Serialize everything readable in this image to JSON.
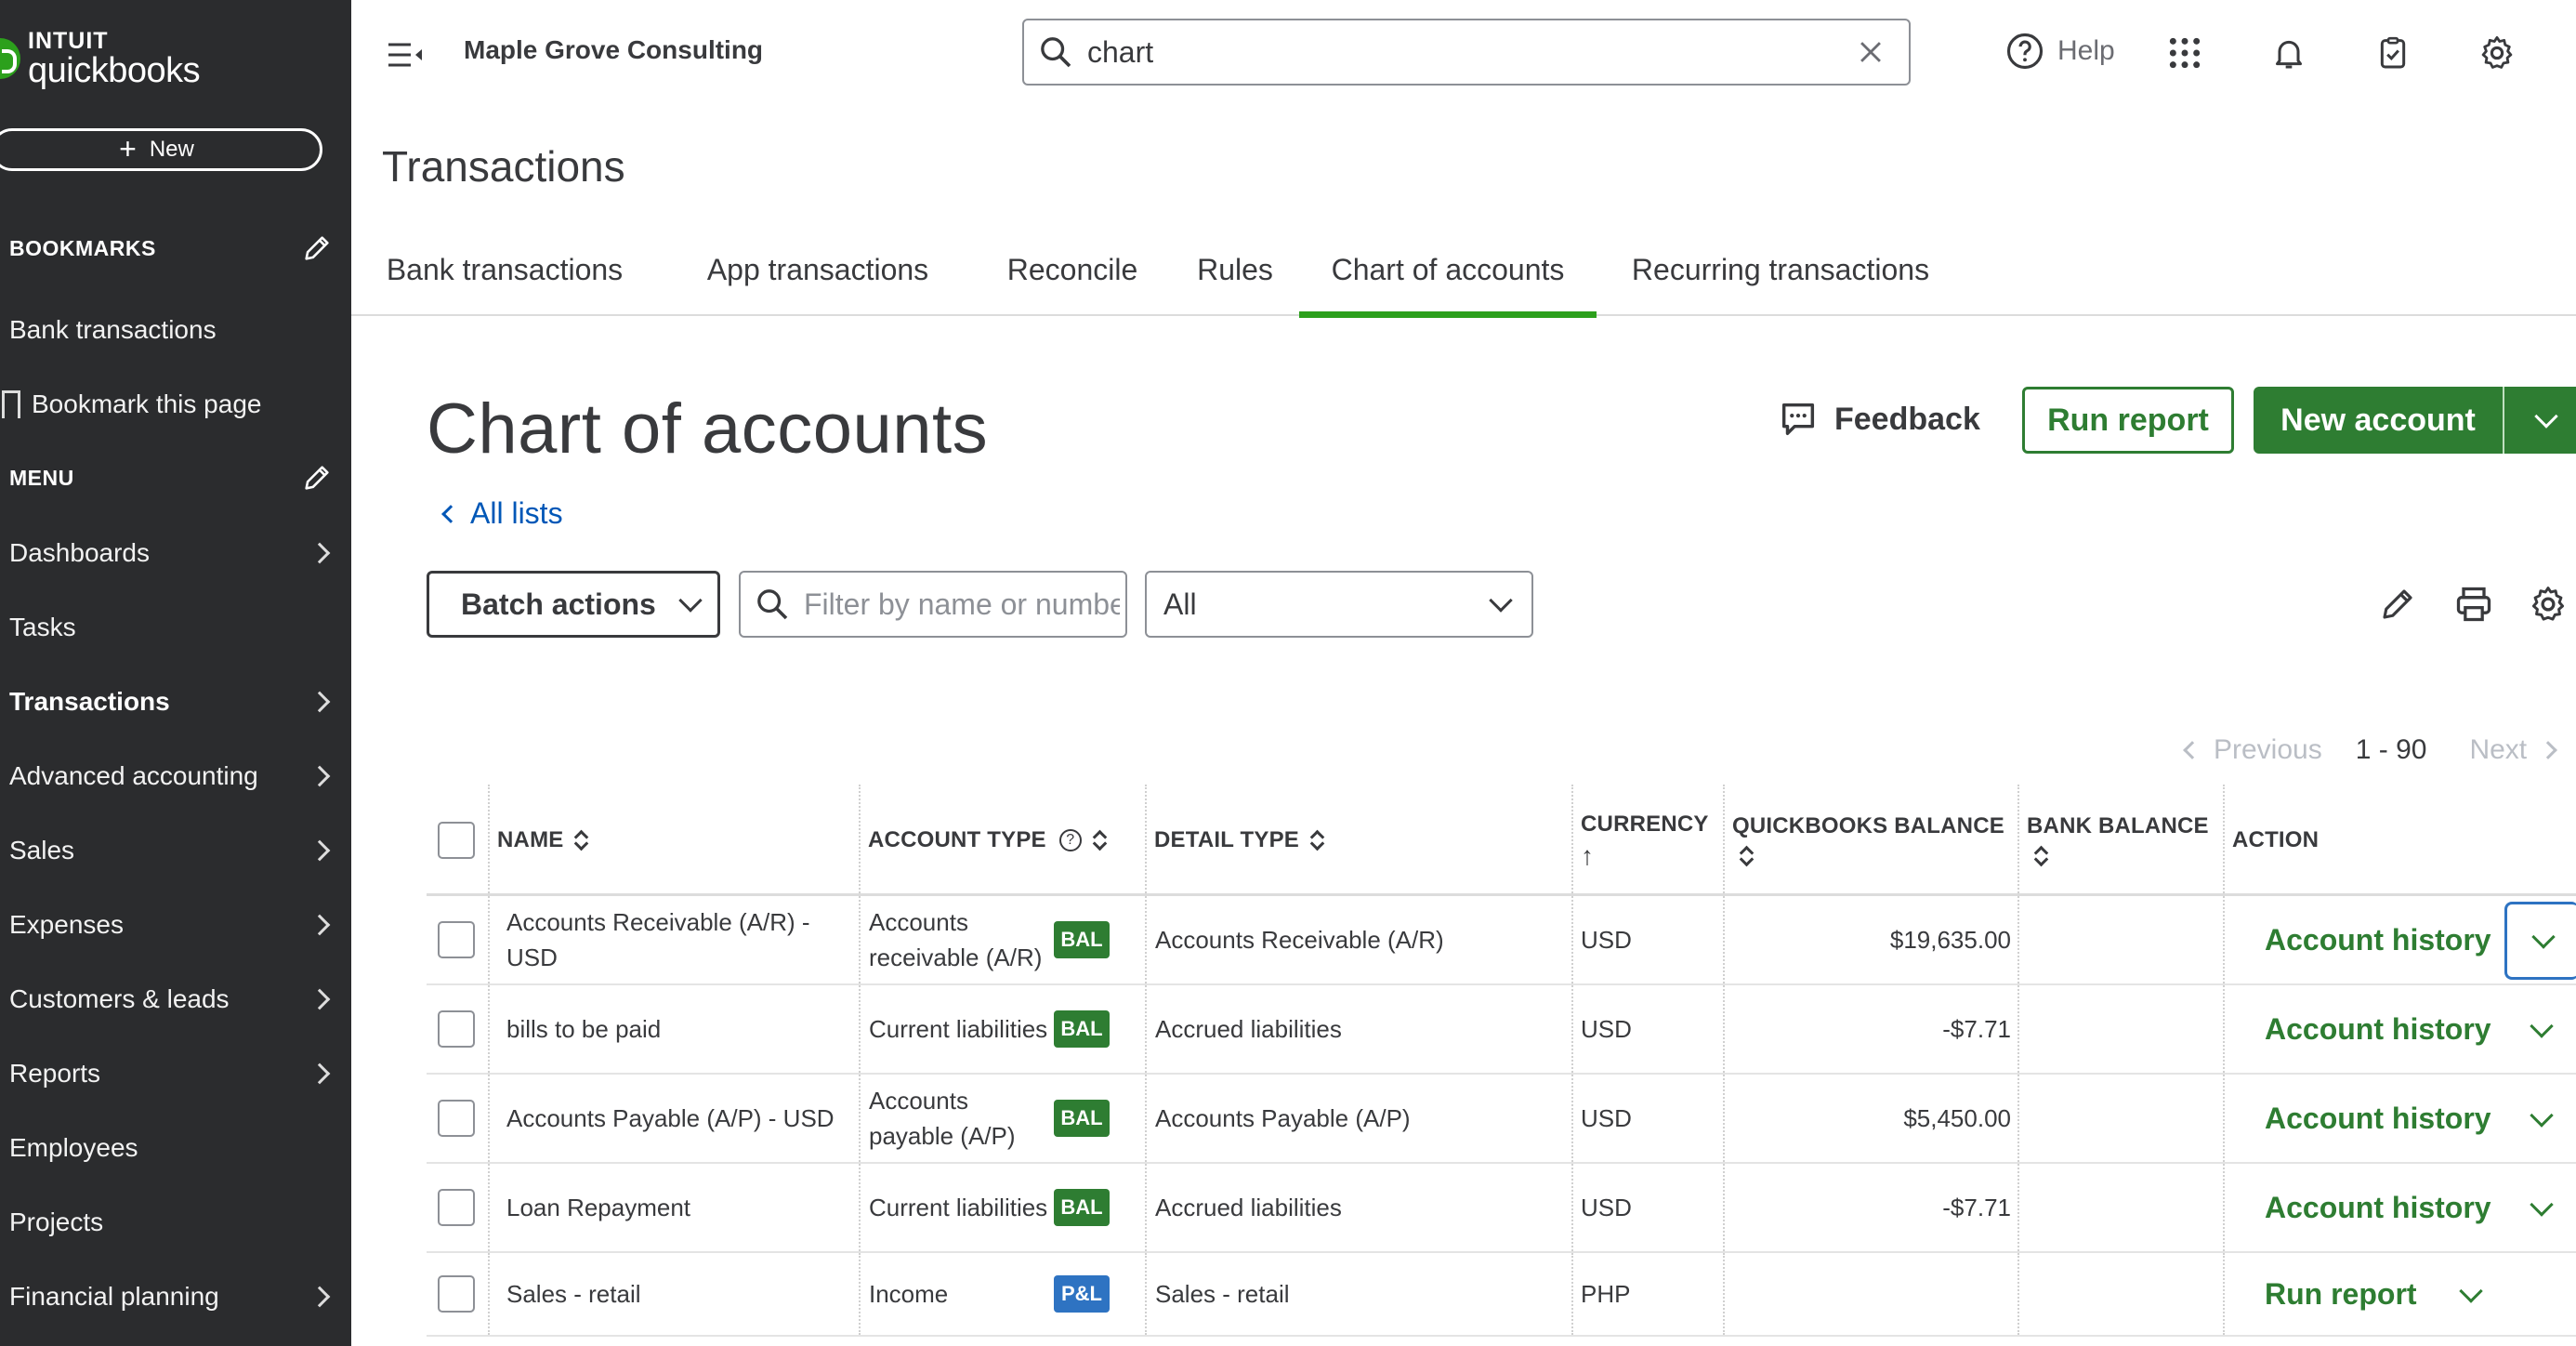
{
  "sidebar": {
    "logo_top": "INTUIT",
    "logo_bottom": "quickbooks",
    "new_label": "New",
    "bookmarks_heading": "BOOKMARKS",
    "bookmarks": [
      "Bank transactions",
      "Bookmark this page"
    ],
    "menu_heading": "MENU",
    "menu": [
      {
        "label": "Dashboards",
        "chevron": true
      },
      {
        "label": "Tasks",
        "chevron": false
      },
      {
        "label": "Transactions",
        "chevron": true,
        "active": true
      },
      {
        "label": "Advanced accounting",
        "chevron": true
      },
      {
        "label": "Sales",
        "chevron": true
      },
      {
        "label": "Expenses",
        "chevron": true
      },
      {
        "label": "Customers & leads",
        "chevron": true
      },
      {
        "label": "Reports",
        "chevron": true
      },
      {
        "label": "Employees",
        "chevron": false
      },
      {
        "label": "Projects",
        "chevron": false
      },
      {
        "label": "Financial planning",
        "chevron": true
      }
    ]
  },
  "topbar": {
    "company": "Maple Grove Consulting",
    "search_value": "chart",
    "help_label": "Help"
  },
  "page": {
    "title": "Transactions",
    "tabs": [
      "Bank transactions",
      "App transactions",
      "Reconcile",
      "Rules",
      "Chart of accounts",
      "Recurring transactions"
    ],
    "active_tab": "Chart of accounts"
  },
  "content": {
    "title": "Chart of accounts",
    "all_lists": "All lists",
    "feedback": "Feedback",
    "run_report": "Run report",
    "new_account": "New account",
    "batch_actions": "Batch actions",
    "filter_placeholder": "Filter by name or number",
    "type_filter_value": "All",
    "pager": {
      "previous": "Previous",
      "range": "1 - 90",
      "next": "Next"
    }
  },
  "table": {
    "headers": {
      "name": "NAME",
      "account_type": "ACCOUNT TYPE",
      "detail_type": "DETAIL TYPE",
      "currency": "CURRENCY",
      "qb_balance": "QUICKBOOKS BALANCE",
      "bank_balance": "BANK BALANCE",
      "action": "ACTION"
    },
    "rows": [
      {
        "name": "Accounts Receivable (A/R) - USD",
        "account_type": "Accounts receivable (A/R)",
        "badge": "BAL",
        "detail_type": "Accounts Receivable (A/R)",
        "currency": "USD",
        "qb_balance": "$19,635.00",
        "bank_balance": "",
        "action": "Account history"
      },
      {
        "name": "bills to be paid",
        "account_type": "Current liabilities",
        "badge": "BAL",
        "detail_type": "Accrued liabilities",
        "currency": "USD",
        "qb_balance": "-$7.71",
        "bank_balance": "",
        "action": "Account history"
      },
      {
        "name": "Accounts Payable (A/P) - USD",
        "account_type": "Accounts payable (A/P)",
        "badge": "BAL",
        "detail_type": "Accounts Payable (A/P)",
        "currency": "USD",
        "qb_balance": "$5,450.00",
        "bank_balance": "",
        "action": "Account history"
      },
      {
        "name": "Loan Repayment",
        "account_type": "Current liabilities",
        "badge": "BAL",
        "detail_type": "Accrued liabilities",
        "currency": "USD",
        "qb_balance": "-$7.71",
        "bank_balance": "",
        "action": "Account history"
      },
      {
        "name": "Sales - retail",
        "account_type": "Income",
        "badge": "P&L",
        "detail_type": "Sales - retail",
        "currency": "PHP",
        "qb_balance": "",
        "bank_balance": "",
        "action": "Run report"
      }
    ]
  },
  "colors": {
    "sidebar_bg": "#2b2c2e",
    "brand_green": "#2ca01c",
    "action_green": "#2e7d32",
    "bal_badge": "#2e7d32",
    "pl_badge": "#2e73c2",
    "link_blue": "#0057b7"
  },
  "icons": {
    "search": "search-icon",
    "clear": "close-icon",
    "help": "help-circle-icon",
    "apps": "app-grid-icon",
    "notifications": "bell-icon",
    "tasks": "clipboard-icon",
    "settings": "gear-icon",
    "feedback": "chat-bubble-icon",
    "edit": "pencil-icon",
    "print": "printer-icon"
  }
}
